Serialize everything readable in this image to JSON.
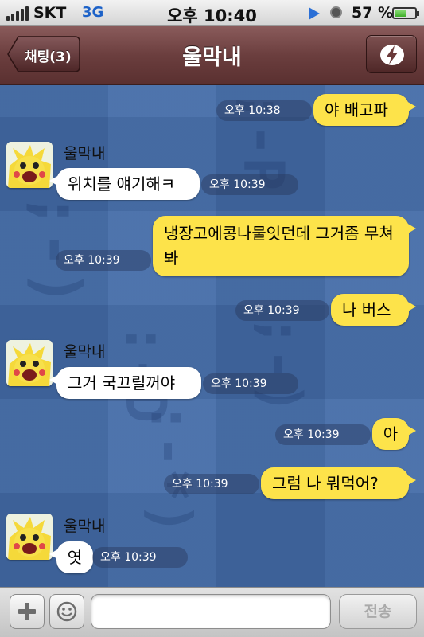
{
  "status_bar": {
    "carrier": "SKT",
    "network": "3G",
    "time": "오후 10:40",
    "battery_percent": "57 %",
    "battery_level": 0.57,
    "icons": [
      "signal-bars-icon",
      "location-arrow-icon",
      "orientation-lock-icon",
      "battery-icon"
    ]
  },
  "nav": {
    "back_label": "채팅(3)",
    "title": "울막내",
    "action_icon": "lightning-icon"
  },
  "messages": [
    {
      "from": "me",
      "text": "야 배고파",
      "time": "오후 10:38"
    },
    {
      "from": "them",
      "sender": "울막내",
      "text": "위치를 얘기해ㅋ",
      "time": "오후 10:39"
    },
    {
      "from": "me",
      "text": "냉장고에콩나물잇던데 그거좀 무쳐봐",
      "time": "오후 10:39"
    },
    {
      "from": "me",
      "text": "나 버스",
      "time": "오후 10:39"
    },
    {
      "from": "them",
      "sender": "울막내",
      "text": "그거 국끄릴꺼야",
      "time": "오후 10:39"
    },
    {
      "from": "me",
      "text": "아",
      "time": "오후 10:39"
    },
    {
      "from": "me",
      "text": "그럼 나 뭐먹어?",
      "time": "오후 10:39"
    },
    {
      "from": "them",
      "sender": "울막내",
      "text": "엿",
      "time": "오후 10:39"
    }
  ],
  "input_bar": {
    "message_value": "",
    "send_label": "전송",
    "icons": [
      "plus-icon",
      "emoticon-icon"
    ]
  },
  "colors": {
    "my_bubble": "#fde34a",
    "their_bubble": "#ffffff",
    "chat_background": "#3a64a3",
    "nav_background": "#6b3e3e"
  }
}
